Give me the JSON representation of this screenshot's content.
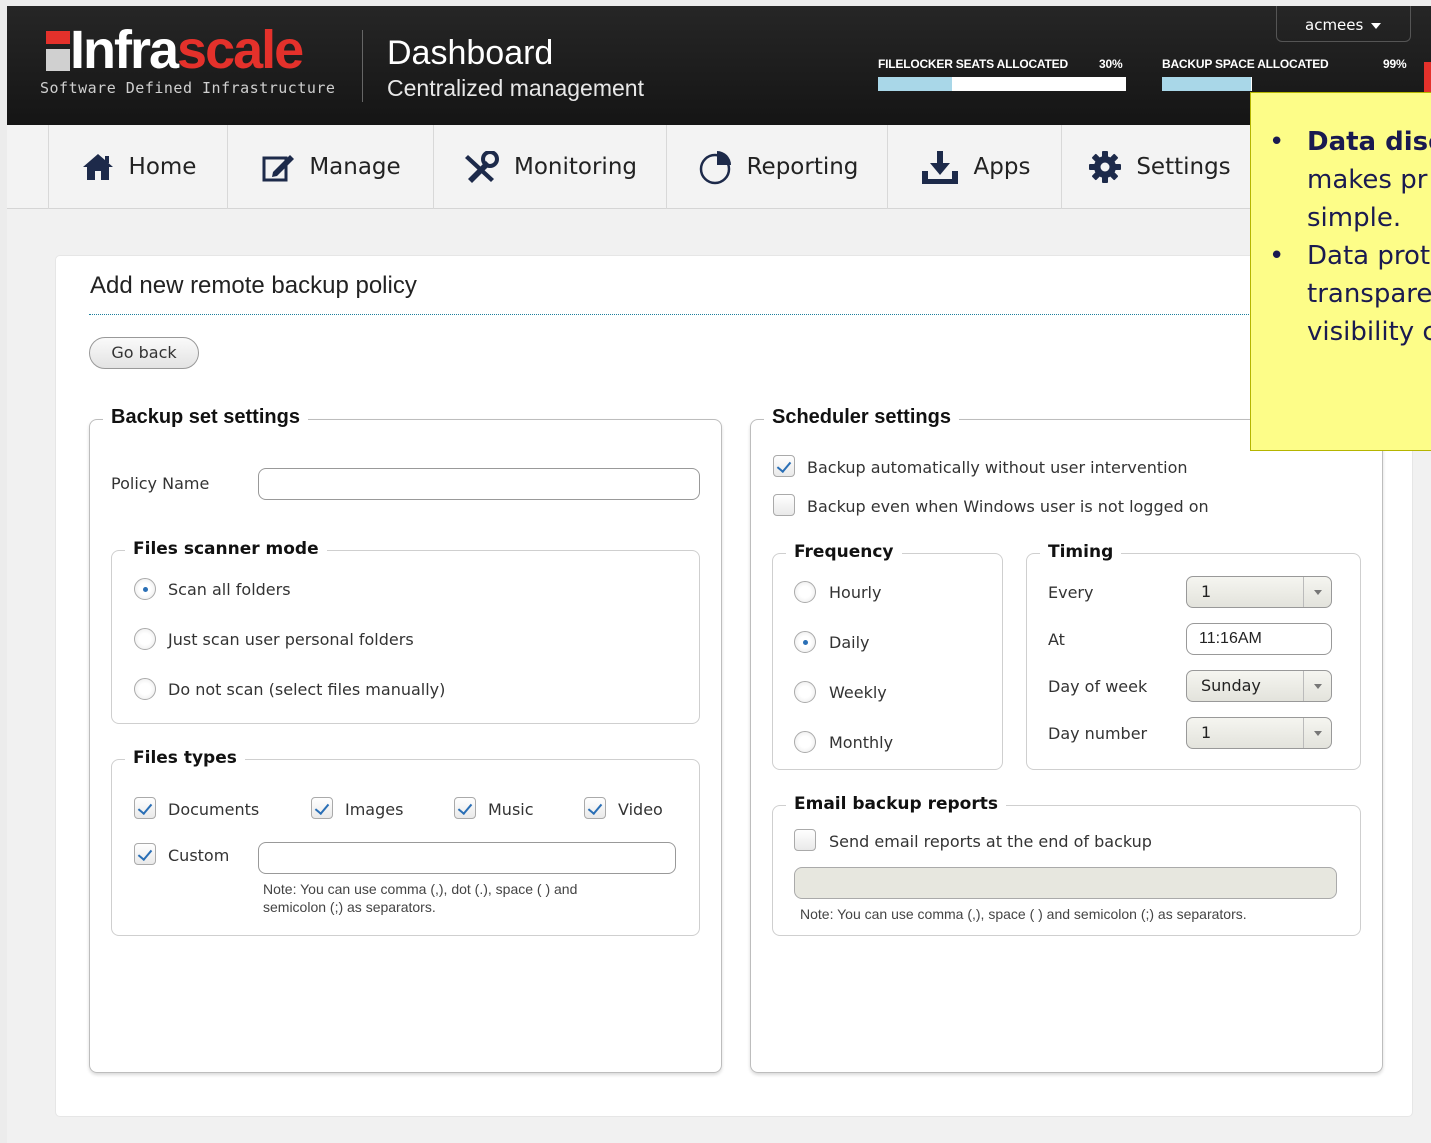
{
  "brand": {
    "logo_part1": "Infra",
    "logo_part2": "scale",
    "logo_tagline": "Software Defined Infrastructure",
    "title": "Dashboard",
    "subtitle": "Centralized management",
    "accent": "#e4312b"
  },
  "user": {
    "name": "acmees"
  },
  "meters": [
    {
      "label": "FILELOCKER SEATS ALLOCATED",
      "value_text": "30%",
      "fraction": 0.3
    },
    {
      "label": "BACKUP SPACE ALLOCATED",
      "value_text": "99%",
      "fraction": 0.99
    }
  ],
  "nav": [
    {
      "label": "Home",
      "icon": "home-icon"
    },
    {
      "label": "Manage",
      "icon": "edit-icon"
    },
    {
      "label": "Monitoring",
      "icon": "tools-icon"
    },
    {
      "label": "Reporting",
      "icon": "pie-chart-icon"
    },
    {
      "label": "Apps",
      "icon": "download-icon"
    },
    {
      "label": "Settings",
      "icon": "gear-icon"
    }
  ],
  "tooltip": {
    "items": [
      {
        "bold": "Data disc",
        "rest": ""
      },
      {
        "bold": "",
        "rest": "makes pr"
      },
      {
        "bold": "",
        "rest": "simple."
      },
      {
        "bold": "",
        "rest": "Data prot"
      },
      {
        "bold": "",
        "rest": "transpare"
      },
      {
        "bold": "",
        "rest": "visibility c"
      }
    ]
  },
  "page": {
    "title": "Add new remote backup policy",
    "go_back": "Go back"
  },
  "backup_set": {
    "legend": "Backup set settings",
    "policy_name_label": "Policy Name",
    "policy_name_value": "",
    "scanner": {
      "legend": "Files scanner mode",
      "options": [
        {
          "label": "Scan all folders",
          "selected": true
        },
        {
          "label": "Just scan user personal folders",
          "selected": false
        },
        {
          "label": "Do not scan (select files manually)",
          "selected": false
        }
      ]
    },
    "types": {
      "legend": "Files types",
      "options": [
        {
          "label": "Documents",
          "checked": true
        },
        {
          "label": "Images",
          "checked": true
        },
        {
          "label": "Music",
          "checked": true
        },
        {
          "label": "Video",
          "checked": true
        }
      ],
      "custom_label": "Custom",
      "custom_checked": true,
      "custom_value": "",
      "note_line1": "Note: You can use comma (,), dot (.), space ( ) and",
      "note_line2": "semicolon (;) as separators."
    }
  },
  "scheduler": {
    "legend": "Scheduler settings",
    "auto_backup": {
      "label": "Backup automatically without user intervention",
      "checked": true
    },
    "not_logged": {
      "label": "Backup even when Windows user is not logged on",
      "checked": false
    },
    "frequency": {
      "legend": "Frequency",
      "options": [
        {
          "label": "Hourly",
          "selected": false
        },
        {
          "label": "Daily",
          "selected": true
        },
        {
          "label": "Weekly",
          "selected": false
        },
        {
          "label": "Monthly",
          "selected": false
        }
      ]
    },
    "timing": {
      "legend": "Timing",
      "every_label": "Every",
      "every_value": "1",
      "at_label": "At",
      "at_value": "11:16AM",
      "dow_label": "Day of week",
      "dow_value": "Sunday",
      "daynum_label": "Day number",
      "daynum_value": "1"
    },
    "email": {
      "legend": "Email backup reports",
      "send_label": "Send email reports at the end of backup",
      "send_checked": false,
      "address_value": "",
      "note": "Note: You can use comma (,), space ( ) and semicolon (;) as separators."
    }
  }
}
